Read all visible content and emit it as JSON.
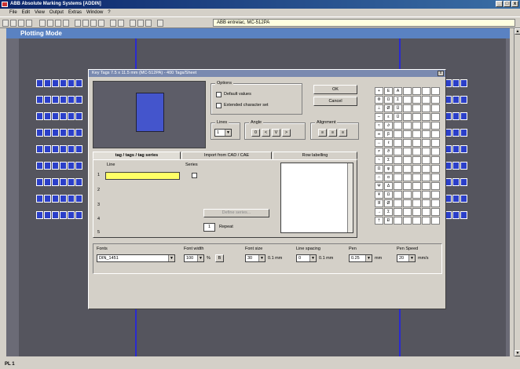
{
  "app": {
    "title": "ABB Absolute Marking Systems [ADDIN]",
    "win_buttons": [
      "_",
      "□",
      "x"
    ]
  },
  "menu": [
    "File",
    "Edit",
    "View",
    "Output",
    "Extras",
    "Window",
    "?"
  ],
  "toolbar": {
    "field_value": "ABB entrelac, MC-512PA"
  },
  "workspace": {
    "title": "Plotting Mode"
  },
  "dialog": {
    "title": "Key Tags 7.5 x 11.5 mm (MC-512PA) - 400 Tags/Sheet",
    "close": "x",
    "options": {
      "label": "Options",
      "default_values": "Default values",
      "extended_charset": "Extended character set"
    },
    "ok": "OK",
    "cancel": "Cancel",
    "lines": {
      "label": "Lines",
      "value": "1"
    },
    "angle": {
      "label": "Angle",
      "buttons": [
        "0",
        "<",
        "V",
        ">"
      ]
    },
    "alignment": {
      "label": "Alignment",
      "buttons": [
        "≡",
        "≡",
        "≡"
      ]
    },
    "tabs": [
      "tag / tags / tag series",
      "Import from CAD / CAE",
      "Row labelling"
    ],
    "line_header": "Line",
    "series_header": "Series",
    "line_numbers": [
      "1",
      "2",
      "3",
      "4",
      "5"
    ],
    "define_series": "Define series...",
    "repeat": {
      "value": "1",
      "label": "Repeat"
    },
    "charmap": [
      "+",
      "E",
      "A",
      "",
      "",
      "",
      "",
      "Φ",
      "Ω",
      "Σ",
      "",
      "",
      "",
      "",
      "⊥",
      "Ø",
      "Ü",
      "",
      "",
      "",
      "",
      "∼",
      "ε",
      "Ü",
      "",
      "",
      "",
      "",
      "≈",
      "∂",
      "",
      "",
      "",
      "",
      "",
      "∞",
      "β",
      "",
      "",
      "",
      "",
      "",
      "↔",
      "ℓ",
      "",
      "",
      "",
      "",
      "",
      "≠",
      "ϑ",
      "",
      "",
      "",
      "",
      "",
      "~",
      "Σ",
      "",
      "",
      "",
      "",
      "",
      "Ω",
      "φ",
      "",
      "",
      "",
      "",
      "",
      "∩",
      "α",
      "",
      "",
      "",
      "",
      "",
      "Ψ",
      "Δ",
      "",
      "",
      "",
      "",
      "",
      "¥",
      "Ω",
      "",
      "",
      "",
      "",
      "",
      "Я",
      "Ø",
      "",
      "",
      "",
      "",
      "",
      "→",
      "Σ",
      "",
      "",
      "",
      "",
      "",
      "†",
      "Ð",
      "",
      "",
      "",
      "",
      ""
    ],
    "bottom": {
      "fonts": {
        "label": "Fonts",
        "value": "DIN_1451"
      },
      "font_width": {
        "label": "Font width",
        "value": "100",
        "unit": "%",
        "bold": "B"
      },
      "font_size": {
        "label": "Font size",
        "value": "30",
        "unit": "0.1 mm"
      },
      "line_spacing": {
        "label": "Line spacing",
        "value": "0",
        "unit": "0.1 mm"
      },
      "pen": {
        "label": "Pen",
        "value": "0.25",
        "unit": "mm"
      },
      "pen_speed": {
        "label": "Pen Speed",
        "value": "20",
        "unit": "mm/s"
      }
    }
  },
  "status": "PL 1"
}
